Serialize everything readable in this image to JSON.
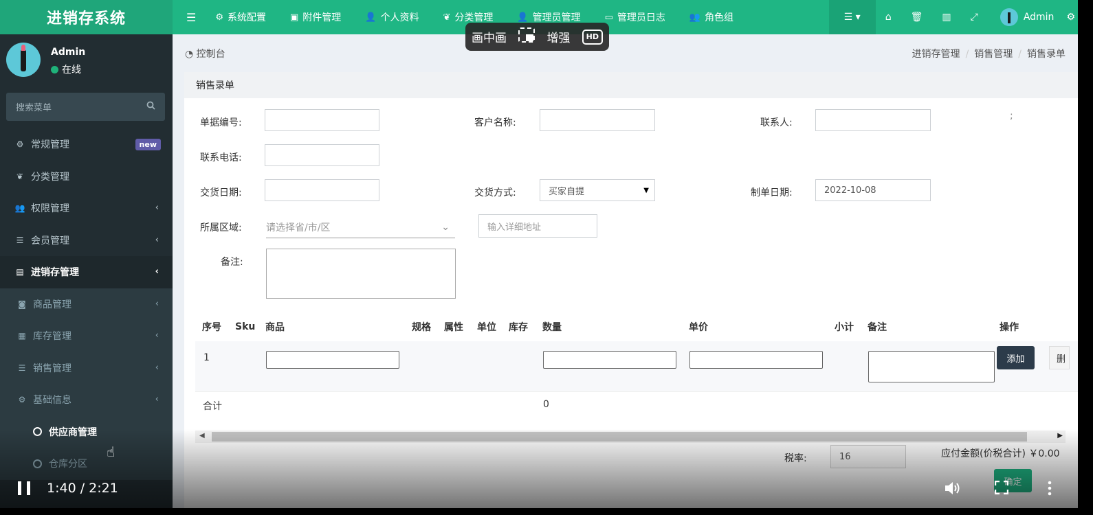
{
  "app": {
    "title": "进销存系统"
  },
  "user": {
    "name": "Admin",
    "status": "在线"
  },
  "sidebar": {
    "search_placeholder": "搜索菜单",
    "items": [
      {
        "label": "常规管理",
        "badge": "new"
      },
      {
        "label": "分类管理"
      },
      {
        "label": "权限管理"
      },
      {
        "label": "会员管理"
      },
      {
        "label": "进销存管理"
      },
      {
        "label": "商品管理"
      },
      {
        "label": "库存管理"
      },
      {
        "label": "销售管理"
      },
      {
        "label": "基础信息"
      },
      {
        "label": "供应商管理"
      },
      {
        "label": "仓库分区"
      }
    ]
  },
  "topbar": {
    "items": [
      "系统配置",
      "附件管理",
      "个人资料",
      "分类管理",
      "管理员管理",
      "管理员日志",
      "角色组"
    ],
    "user": "Admin"
  },
  "pip": {
    "label": "画中画",
    "enhance": "增强",
    "hd": "HD"
  },
  "breadcrumb": {
    "home": "控制台",
    "path": [
      "进销存管理",
      "销售管理",
      "销售录单"
    ]
  },
  "panel": {
    "title": "销售录单"
  },
  "form": {
    "bill_no": {
      "label": "单据编号:",
      "value": ""
    },
    "customer": {
      "label": "客户名称:",
      "value": ""
    },
    "contact": {
      "label": "联系人:",
      "value": ""
    },
    "phone": {
      "label": "联系电话:",
      "value": ""
    },
    "delivery_date": {
      "label": "交货日期:",
      "value": ""
    },
    "delivery_method": {
      "label": "交货方式:",
      "value": "买家自提"
    },
    "create_date": {
      "label": "制单日期:",
      "value": "2022-10-08"
    },
    "region": {
      "label": "所属区域:",
      "placeholder": "请选择省/市/区",
      "address_placeholder": "输入详细地址"
    },
    "remark": {
      "label": "备注:"
    },
    "stray": ";"
  },
  "table": {
    "headers": [
      "序号",
      "Sku",
      "商品",
      "规格",
      "属性",
      "单位",
      "库存",
      "数量",
      "单价",
      "小计",
      "备注",
      "操作"
    ],
    "rows": [
      {
        "no": "1"
      }
    ],
    "total_label": "合计",
    "total_qty": "0",
    "add_label": "添加",
    "del_label": "删"
  },
  "footer": {
    "tax_label": "税率:",
    "tax_value": "16",
    "payable": "应付金额(价税合计) ￥0.00",
    "confirm": "确定"
  },
  "video": {
    "time": "1:40 / 2:21"
  }
}
